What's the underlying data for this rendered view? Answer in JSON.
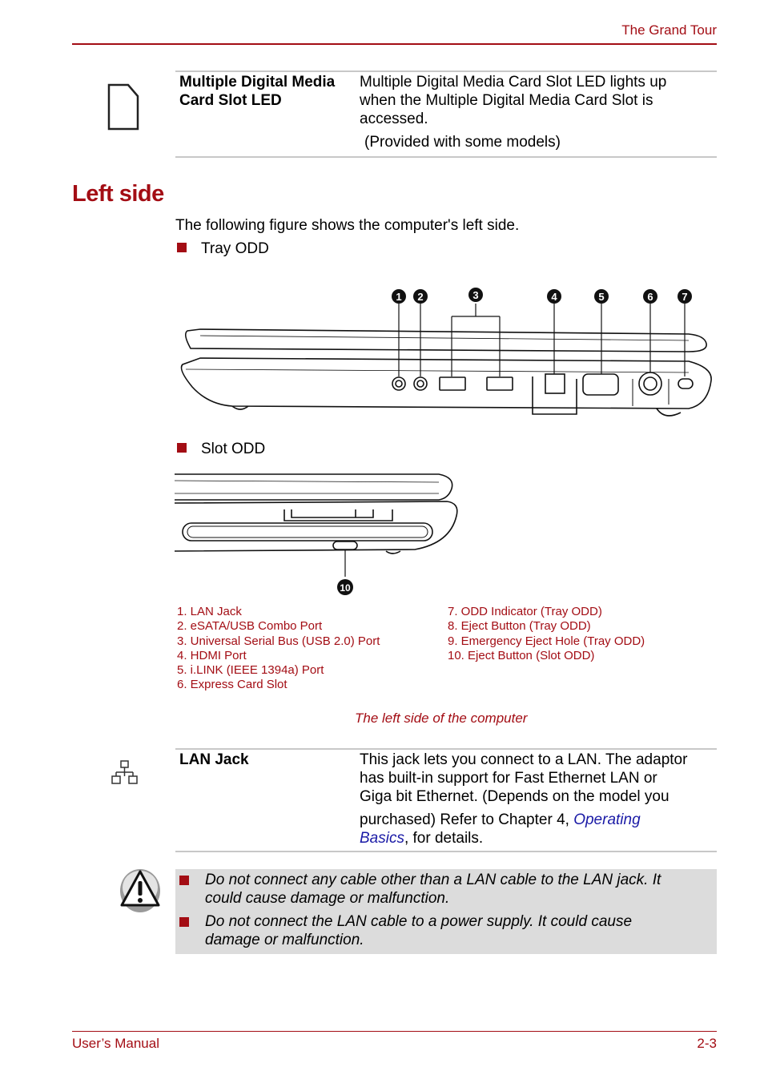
{
  "header": {
    "title": "The Grand Tour"
  },
  "top_table": {
    "icon": "card-slot-led-icon",
    "term_lines": [
      "Multiple Digital Media",
      "Card Slot LED"
    ],
    "desc_lines": [
      "Multiple Digital Media Card Slot LED lights up",
      "when the Multiple Digital Media Card Slot is",
      "accessed."
    ],
    "note": "(Provided with some models)"
  },
  "section": {
    "title": "Left side",
    "intro": "The following figure shows the computer's left side.",
    "tray_label": "Tray ODD",
    "slot_label": "Slot ODD"
  },
  "figure": {
    "tray_callouts": [
      "1",
      "2",
      "3",
      "4",
      "5",
      "6",
      "7"
    ],
    "slot_callout": "10",
    "legend_left": [
      "1. LAN Jack",
      "2. eSATA/USB Combo Port",
      "3. Universal Serial Bus (USB 2.0) Port",
      "4. HDMI Port",
      "5. i.LINK (IEEE 1394a) Port",
      "6. Express Card Slot"
    ],
    "legend_right": [
      "7. ODD Indicator (Tray ODD)",
      "8. Eject Button (Tray ODD)",
      "9. Emergency Eject Hole (Tray ODD)",
      "10. Eject Button (Slot ODD)"
    ],
    "caption": "The left side of the computer"
  },
  "lan_table": {
    "icon": "lan-network-icon",
    "term": "LAN Jack",
    "desc_lines": [
      "This jack lets you connect to a LAN. The adaptor",
      "has built-in support for Fast Ethernet LAN or",
      "Giga bit Ethernet. (Depends on the model you"
    ],
    "desc_tail_prefix": "purchased) Refer to Chapter 4, ",
    "link_line1": "Operating",
    "link_line2": "Basics",
    "desc_tail_suffix": ", for details."
  },
  "warning": {
    "icon": "warning-icon",
    "items": [
      [
        "Do not connect any cable other than a LAN cable to the LAN jack. It",
        "could cause damage or malfunction."
      ],
      [
        "Do not connect the LAN cable to a power supply. It could cause",
        "damage or malfunction."
      ]
    ]
  },
  "footer": {
    "left": "User’s Manual",
    "right": "2-3"
  }
}
